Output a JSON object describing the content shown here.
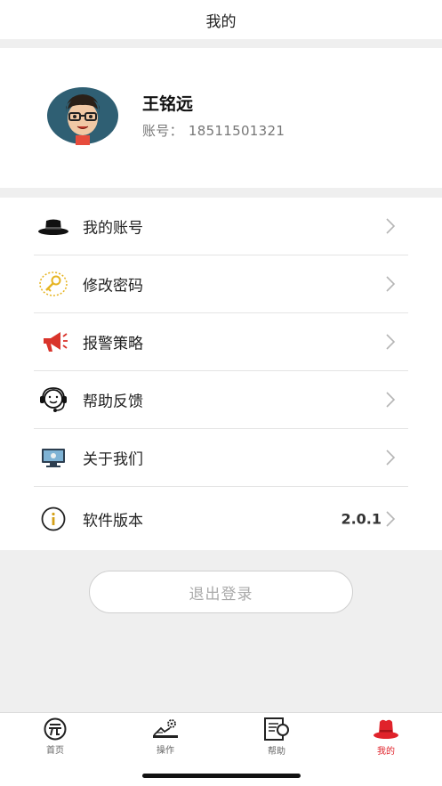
{
  "header": {
    "title": "我的"
  },
  "profile": {
    "name": "王铭远",
    "account_label": "账号：",
    "account_number": "18511501321",
    "avatar_icon": "cartoon-avatar-with-glasses"
  },
  "menu": {
    "items": [
      {
        "label": "我的账号",
        "icon": "hat-icon"
      },
      {
        "label": "修改密码",
        "icon": "key-icon"
      },
      {
        "label": "报警策略",
        "icon": "megaphone-icon"
      },
      {
        "label": "帮助反馈",
        "icon": "headset-icon"
      },
      {
        "label": "关于我们",
        "icon": "monitor-icon"
      },
      {
        "label": "软件版本",
        "icon": "info-icon",
        "value": "2.0.1"
      }
    ]
  },
  "logout": {
    "label": "退出登录"
  },
  "tabs": [
    {
      "label": "首页",
      "icon": "home-logo-icon",
      "active": false
    },
    {
      "label": "操作",
      "icon": "operation-icon",
      "active": false
    },
    {
      "label": "帮助",
      "icon": "help-book-icon",
      "active": false
    },
    {
      "label": "我的",
      "icon": "profile-hat-icon",
      "active": true
    }
  ],
  "colors": {
    "active_tab": "#e0232b",
    "page_background": "#efefef",
    "key_icon": "#e6b422"
  }
}
